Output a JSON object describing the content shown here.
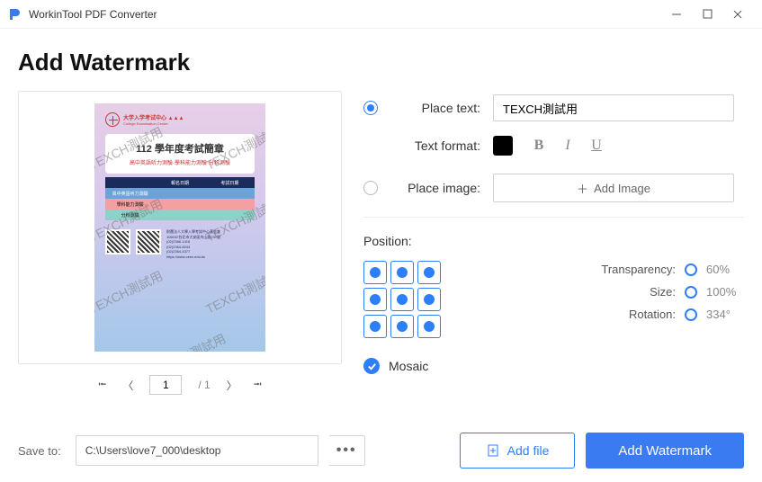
{
  "window": {
    "title": "WorkinTool PDF Converter"
  },
  "page": {
    "heading": "Add Watermark"
  },
  "preview": {
    "doc": {
      "logotext": "大学入学考试中心 ▲▲▲",
      "logosub": "College Examination Center",
      "card_title": "112 學年度考試簡章",
      "card_sub": "高中英語听力測驗·學科能力測驗·分科測驗",
      "th1": "",
      "th2": "報名日期",
      "th3": "考試日期",
      "tr1a": "高中英語听力測驗",
      "tr2a": "學科能力測驗",
      "tr3a": "分科測驗",
      "info1": "財團法人大學入學考試中心基金會",
      "info2": "106032台北市大安區舟山路237號",
      "info3": "(02)2366-1416",
      "info4": "(02)2364-8243",
      "info5": "(02)2364-4377",
      "info6": "https://www.ceec.edu.tw"
    },
    "watermark_text": "TEXCH測試用",
    "pager": {
      "current": "1",
      "total": "/ 1"
    }
  },
  "settings": {
    "place_text_label": "Place text:",
    "place_text_value": "TEXCH測試用",
    "text_format_label": "Text format:",
    "bold": "B",
    "italic": "I",
    "underline": "U",
    "place_image_label": "Place image:",
    "add_image_btn": "Add Image",
    "position_label": "Position:",
    "transparency_label": "Transparency:",
    "transparency_value": "60%",
    "size_label": "Size:",
    "size_value": "100%",
    "rotation_label": "Rotation:",
    "rotation_value": "334°",
    "mosaic_label": "Mosaic"
  },
  "footer": {
    "save_to_label": "Save to:",
    "save_to_path": "C:\\Users\\love7_000\\desktop",
    "add_file": "Add file",
    "add_watermark": "Add Watermark"
  }
}
